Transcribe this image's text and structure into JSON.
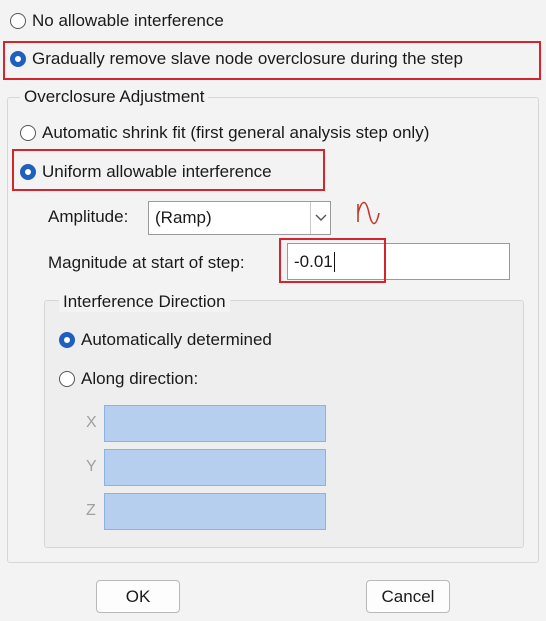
{
  "options": {
    "no_interference": "No allowable interference",
    "gradually_remove": "Gradually remove slave node overclosure during the step"
  },
  "overclosure_group": {
    "title": "Overclosure Adjustment",
    "auto_shrink": "Automatic shrink fit (first general analysis step only)",
    "uniform": "Uniform allowable interference",
    "amplitude_label": "Amplitude:",
    "amplitude_value": "(Ramp)",
    "magnitude_label": "Magnitude at start of step:",
    "magnitude_value": "-0.01"
  },
  "interference_group": {
    "title": "Interference Direction",
    "auto_determined": "Automatically determined",
    "along_direction": "Along direction:",
    "x_label": "X",
    "y_label": "Y",
    "z_label": "Z"
  },
  "buttons": {
    "ok": "OK",
    "cancel": "Cancel"
  },
  "colors": {
    "highlight": "#d6242c",
    "radio_selected": "#1f5fbf",
    "coord_field": "#b6cfee"
  },
  "icons": {
    "amplitude_plot": "amplitude-curve-icon",
    "dropdown": "chevron-down-icon"
  }
}
